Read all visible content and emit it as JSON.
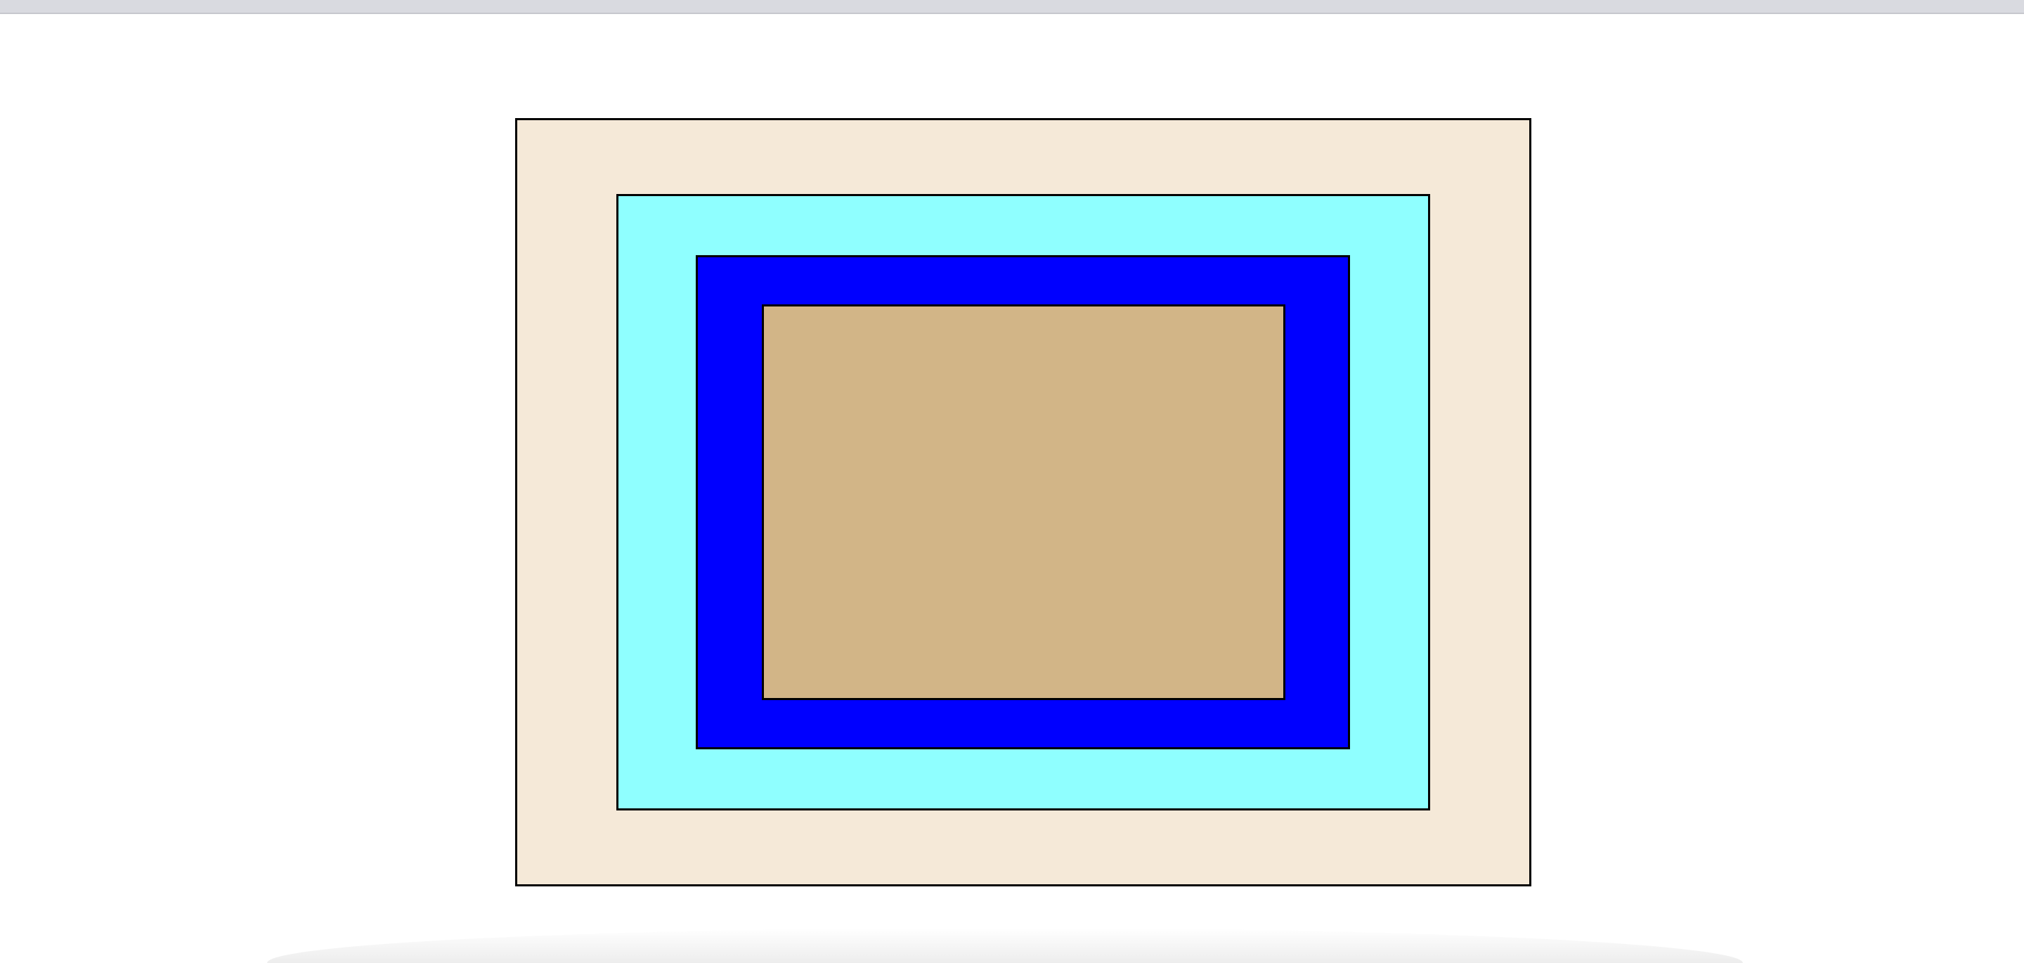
{
  "colors": {
    "page_background": "#ffffff",
    "top_strip": "#d9dae0",
    "border": "#000000"
  },
  "rectangles": [
    {
      "name": "outer",
      "fill": "#f5e9d8"
    },
    {
      "name": "second",
      "fill": "#8fffff"
    },
    {
      "name": "third",
      "fill": "#0000ff"
    },
    {
      "name": "inner",
      "fill": "#d2b587"
    }
  ]
}
